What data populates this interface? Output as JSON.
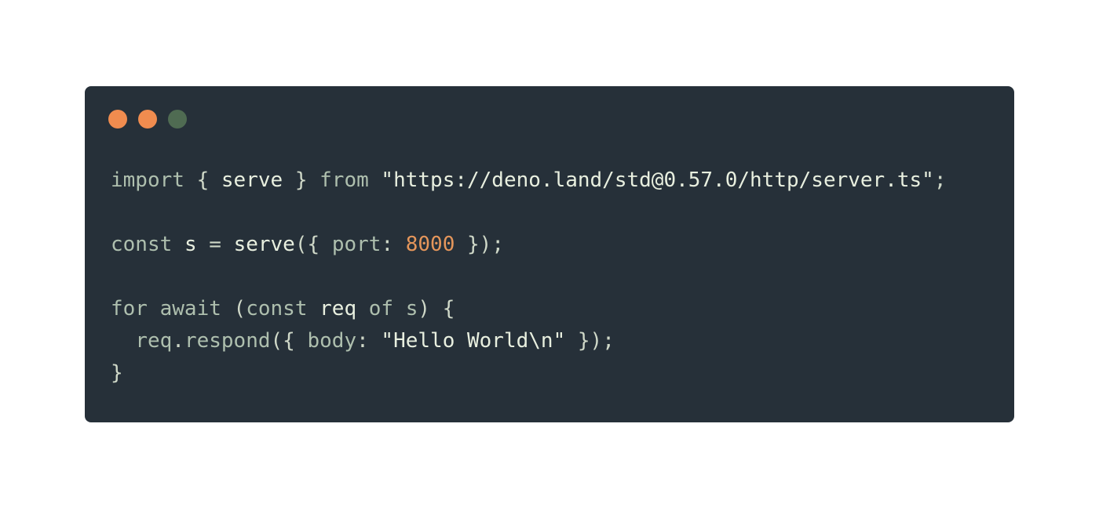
{
  "window": {
    "background": "#263039",
    "traffic_lights": {
      "close_color": "#f08c4f",
      "minimize_color": "#f08c4f",
      "maximize_color": "#4f6b52"
    }
  },
  "code": {
    "lines": [
      [
        "import",
        " { ",
        "serve",
        " } ",
        "from",
        " ",
        "\"https://deno.land/std@0.57.0/http/server.ts\"",
        ";"
      ],
      [],
      [
        "const",
        " ",
        "s",
        " = ",
        "serve",
        "({ ",
        "port",
        ": ",
        "8000",
        " });"
      ],
      [],
      [
        "for",
        " ",
        "await",
        " (",
        "const",
        " ",
        "req",
        " ",
        "of",
        " ",
        "s",
        ") {"
      ],
      [
        "  ",
        "req",
        ".",
        "respond",
        "({ ",
        "body",
        ": ",
        "\"Hello World\\n\"",
        " });"
      ],
      [
        "}"
      ]
    ]
  }
}
